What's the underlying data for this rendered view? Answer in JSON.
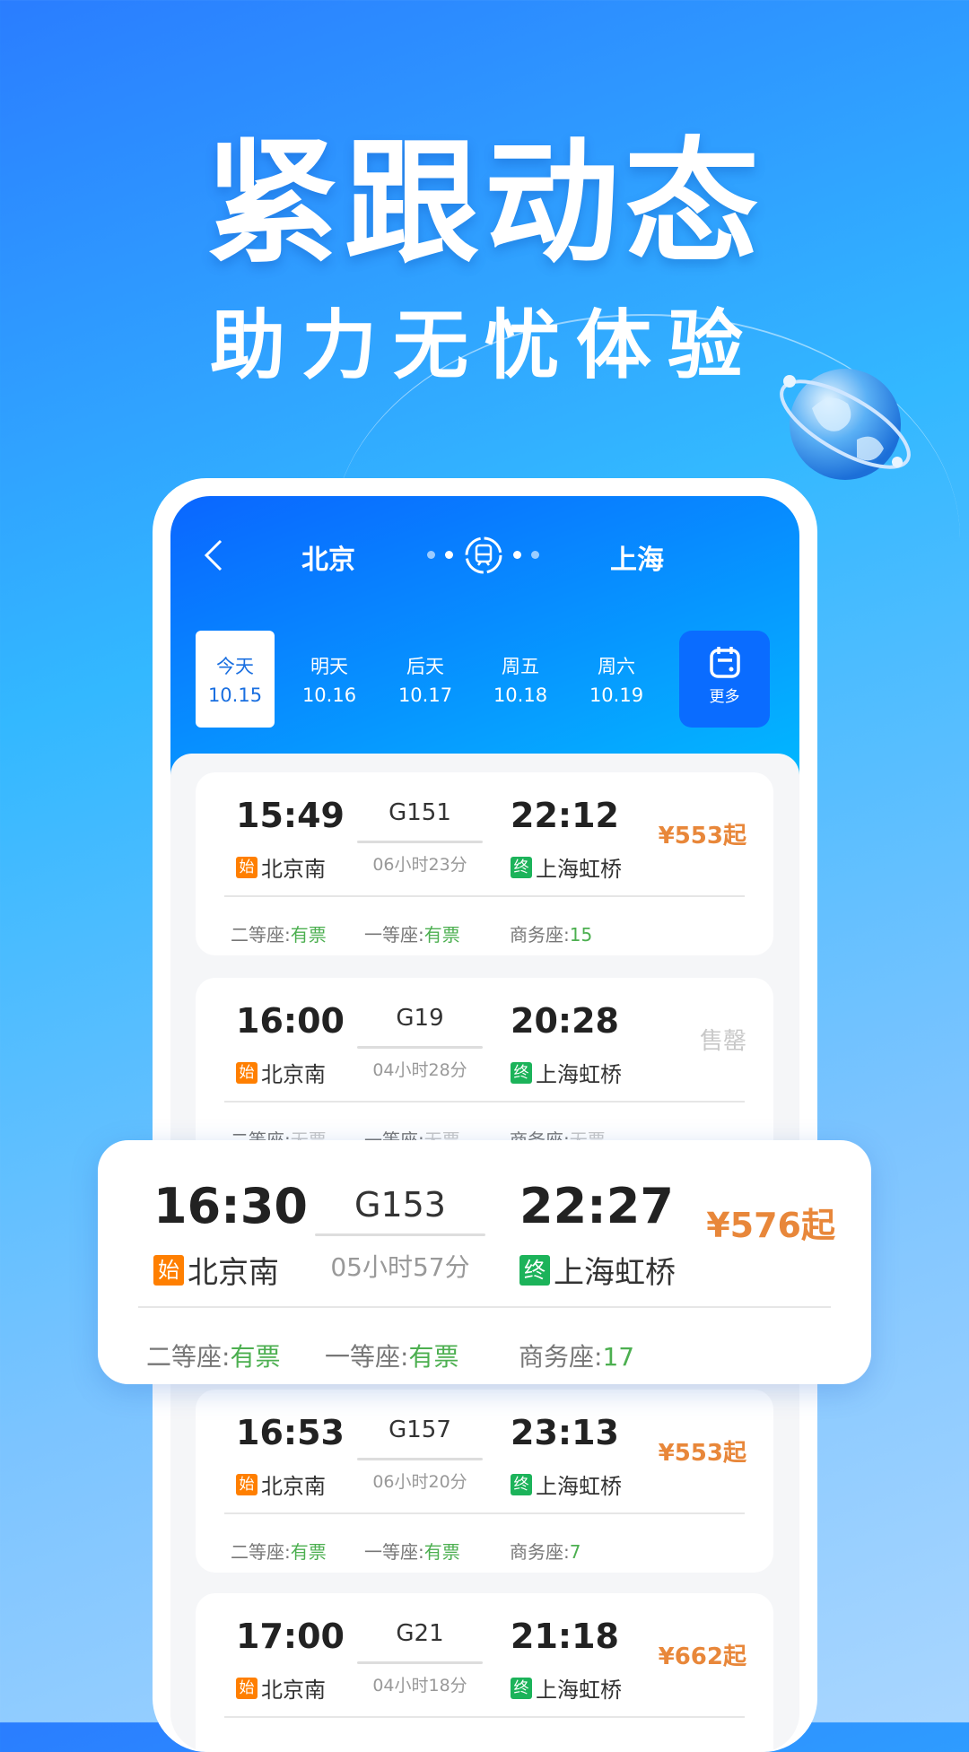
{
  "headline": "紧跟动态",
  "subtitle": "助力无忧体验",
  "header": {
    "from": "北京",
    "to": "上海"
  },
  "dates": [
    {
      "day": "今天",
      "date": "10.15",
      "selected": true
    },
    {
      "day": "明天",
      "date": "10.16"
    },
    {
      "day": "后天",
      "date": "10.17"
    },
    {
      "day": "周五",
      "date": "10.18"
    },
    {
      "day": "周六",
      "date": "10.19"
    }
  ],
  "more_label": "更多",
  "start_badge": "始",
  "end_badge": "终",
  "trains": [
    {
      "dep": "15:49",
      "no": "G151",
      "dur": "06小时23分",
      "arr": "22:12",
      "from": "北京南",
      "to": "上海虹桥",
      "price": "¥553起",
      "seats": [
        [
          "二等座:",
          "有票"
        ],
        [
          "一等座:",
          "有票"
        ],
        [
          "商务座:",
          "15"
        ]
      ]
    },
    {
      "dep": "16:00",
      "no": "G19",
      "dur": "04小时28分",
      "arr": "20:28",
      "from": "北京南",
      "to": "上海虹桥",
      "price": "售罄",
      "seats": [
        [
          "二等座:",
          "无票"
        ],
        [
          "一等座:",
          "无票"
        ],
        [
          "商务座:",
          "无票"
        ]
      ]
    },
    {
      "dep": "16:53",
      "no": "G157",
      "dur": "06小时20分",
      "arr": "23:13",
      "from": "北京南",
      "to": "上海虹桥",
      "price": "¥553起",
      "seats": [
        [
          "二等座:",
          "有票"
        ],
        [
          "一等座:",
          "有票"
        ],
        [
          "商务座:",
          "7"
        ]
      ]
    },
    {
      "dep": "17:00",
      "no": "G21",
      "dur": "04小时18分",
      "arr": "21:18",
      "from": "北京南",
      "to": "上海虹桥",
      "price": "¥662起",
      "seats": []
    }
  ],
  "highlight": {
    "dep": "16:30",
    "no": "G153",
    "dur": "05小时57分",
    "arr": "22:27",
    "from": "北京南",
    "to": "上海虹桥",
    "price": "¥576起",
    "seats": [
      [
        "二等座:",
        "有票"
      ],
      [
        "一等座:",
        "有票"
      ],
      [
        "商务座:",
        "17"
      ]
    ]
  },
  "colors": {
    "price": "#e8873a",
    "available": "#4caf50",
    "start_badge": "#ff7f00",
    "end_badge": "#1cb35a",
    "header": "#0a66ff"
  }
}
